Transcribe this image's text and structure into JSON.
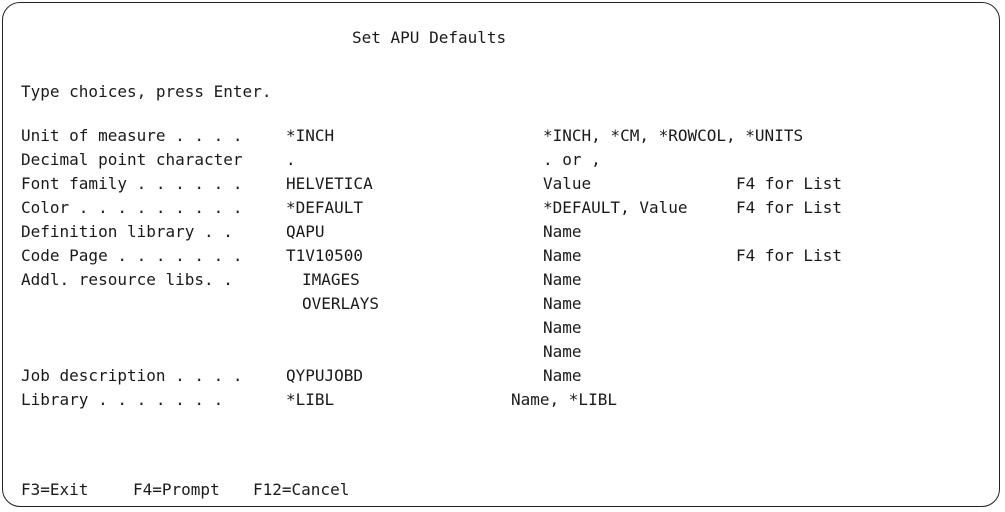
{
  "title": "Set APU Defaults",
  "instruction": "Type choices, press Enter.",
  "fields": [
    {
      "label": "Unit of measure . . . .",
      "value": "*INCH",
      "choices": "*INCH, *CM, *ROWCOL, *UNITS",
      "hint": ""
    },
    {
      "label": "Decimal point character",
      "value": ".",
      "choices": ". or ,",
      "hint": ""
    },
    {
      "label": "Font family . . . . . .",
      "value": "HELVETICA",
      "choices": "Value",
      "hint": "F4 for List"
    },
    {
      "label": "Color . . . . . . . . .",
      "value": "*DEFAULT",
      "choices": "*DEFAULT, Value",
      "hint": "F4 for List"
    },
    {
      "label": "Definition library . .",
      "value": "QAPU",
      "choices": "Name",
      "hint": ""
    },
    {
      "label": "Code Page . . . . . . .",
      "value": "T1V10500",
      "choices": "Name",
      "hint": "F4 for List"
    },
    {
      "label": "Addl. resource libs. .",
      "value": "IMAGES",
      "choices": "Name",
      "hint": ""
    },
    {
      "label": "",
      "value": "OVERLAYS",
      "choices": "Name",
      "hint": ""
    },
    {
      "label": "",
      "value": "",
      "choices": "Name",
      "hint": ""
    },
    {
      "label": "",
      "value": "",
      "choices": "Name",
      "hint": ""
    },
    {
      "label": "Job description . . . .",
      "value": "QYPUJOBD",
      "choices": "Name",
      "hint": ""
    },
    {
      "label": "Library . . . . . . .",
      "value": "*LIBL",
      "choices": "Name, *LIBL",
      "hint": ""
    }
  ],
  "function_keys": {
    "f3": "F3=Exit",
    "f4": "F4=Prompt",
    "f12": "F12=Cancel"
  }
}
